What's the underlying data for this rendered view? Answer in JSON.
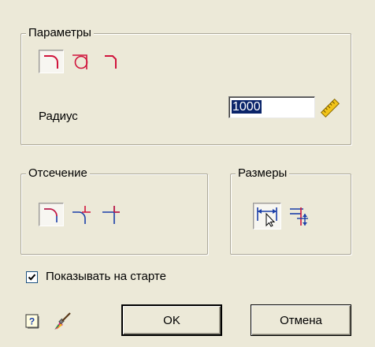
{
  "params": {
    "title": "Параметры",
    "radius_label": "Радиус",
    "radius_value": "1000",
    "icons": [
      "fillet-arc-icon",
      "fillet-circle-icon",
      "fillet-corner-icon"
    ],
    "selected_index": 0
  },
  "trim": {
    "title": "Отсечение",
    "icons": [
      "trim-both-icon",
      "trim-one-side-icon",
      "no-trim-icon"
    ],
    "selected_index": 0
  },
  "dimensions": {
    "title": "Размеры",
    "icons": [
      "dimension-horizontal-icon",
      "dimension-vertical-icon"
    ],
    "selected_index": 0
  },
  "show_on_start": {
    "label": "Показывать на старте",
    "checked": true
  },
  "buttons": {
    "ok": "OK",
    "cancel": "Отмена"
  },
  "colors": {
    "line": "#d0143c",
    "dim": "#1a3ea8",
    "dialog_bg": "#ece9d8",
    "selection": "#0a246a"
  }
}
